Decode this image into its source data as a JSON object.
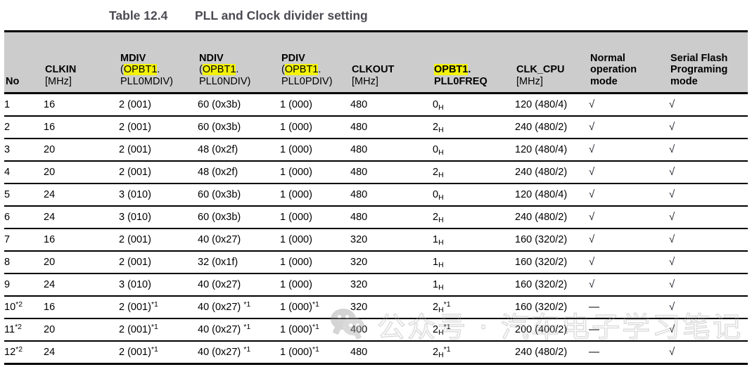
{
  "caption": {
    "label": "Table 12.4",
    "title": "PLL and Clock divider setting"
  },
  "colors": {
    "header_bg": "#cccccc",
    "highlight": "#f2f20a",
    "caption_text": "#4a4a52",
    "rule": "#000000"
  },
  "table": {
    "headers": [
      {
        "main": "",
        "line2": "",
        "line3": "No",
        "bold_lines": [
          3
        ]
      },
      {
        "main": "CLKIN",
        "line3": "[MHz]"
      },
      {
        "main": "MDIV",
        "line2_prefix": "(",
        "line2_hl": "OPBT1",
        "line2_suffix": ".",
        "line3": "PLL0MDIV)"
      },
      {
        "main": "NDIV",
        "line2_prefix": "(",
        "line2_hl": "OPBT1",
        "line2_suffix": ".",
        "line3": "PLL0NDIV)"
      },
      {
        "main": "PDIV",
        "line2_prefix": "(",
        "line2_hl": "OPBT1",
        "line2_suffix": ".",
        "line3": "PLL0PDIV)"
      },
      {
        "main": "CLKOUT",
        "line3": "[MHz]"
      },
      {
        "main": "",
        "line2_hl": "OPBT1",
        "line2_suffix": ".",
        "line3": "PLL0FREQ"
      },
      {
        "main": "CLK_CPU",
        "line3": "[MHz]"
      },
      {
        "main": "Normal",
        "line2": "operation",
        "line3": "mode"
      },
      {
        "main": "Serial Flash",
        "line2": "Programing",
        "line3": "mode"
      }
    ],
    "header_labels": {
      "no": "No",
      "clkin": "CLKIN",
      "clkin_unit": "[MHz]",
      "mdiv": "MDIV",
      "mdiv_reg_open": "(",
      "mdiv_reg_hl": "OPBT1",
      "mdiv_reg_dot": ".",
      "mdiv_reg_rest": "PLL0MDIV)",
      "ndiv": "NDIV",
      "ndiv_reg_open": "(",
      "ndiv_reg_hl": "OPBT1",
      "ndiv_reg_dot": ".",
      "ndiv_reg_rest": "PLL0NDIV)",
      "pdiv": "PDIV",
      "pdiv_reg_open": "(",
      "pdiv_reg_hl": "OPBT1",
      "pdiv_reg_dot": ".",
      "pdiv_reg_rest": "PLL0PDIV)",
      "clkout": "CLKOUT",
      "clkout_unit": "[MHz]",
      "freq_hl": "OPBT1",
      "freq_dot": ".",
      "freq_rest": "PLL0FREQ",
      "clk_cpu": "CLK_CPU",
      "clk_cpu_unit": "[MHz]",
      "normal_l1": "Normal",
      "normal_l2": "operation",
      "normal_l3": "mode",
      "serial_l1": "Serial Flash",
      "serial_l2": "Programing",
      "serial_l3": "mode"
    },
    "rows": [
      {
        "no": "1",
        "no_sup": "",
        "clkin": "16",
        "mdiv": "2 (001)",
        "mdiv_sup": "",
        "ndiv": "60 (0x3b)",
        "ndiv_sup": "",
        "pdiv": "1 (000)",
        "pdiv_sup": "",
        "clkout": "480",
        "freq": "0",
        "freq_sub": "H",
        "freq_sup": "",
        "clk_cpu": "120 (480/4)",
        "normal": "√",
        "serial": "√"
      },
      {
        "no": "2",
        "no_sup": "",
        "clkin": "16",
        "mdiv": "2 (001)",
        "mdiv_sup": "",
        "ndiv": "60 (0x3b)",
        "ndiv_sup": "",
        "pdiv": "1 (000)",
        "pdiv_sup": "",
        "clkout": "480",
        "freq": "2",
        "freq_sub": "H",
        "freq_sup": "",
        "clk_cpu": "240 (480/2)",
        "normal": "√",
        "serial": "√"
      },
      {
        "no": "3",
        "no_sup": "",
        "clkin": "20",
        "mdiv": "2 (001)",
        "mdiv_sup": "",
        "ndiv": "48 (0x2f)",
        "ndiv_sup": "",
        "pdiv": "1 (000)",
        "pdiv_sup": "",
        "clkout": "480",
        "freq": "0",
        "freq_sub": "H",
        "freq_sup": "",
        "clk_cpu": "120 (480/4)",
        "normal": "√",
        "serial": "√"
      },
      {
        "no": "4",
        "no_sup": "",
        "clkin": "20",
        "mdiv": "2 (001)",
        "mdiv_sup": "",
        "ndiv": "48 (0x2f)",
        "ndiv_sup": "",
        "pdiv": "1 (000)",
        "pdiv_sup": "",
        "clkout": "480",
        "freq": "2",
        "freq_sub": "H",
        "freq_sup": "",
        "clk_cpu": "240 (480/2)",
        "normal": "√",
        "serial": "√"
      },
      {
        "no": "5",
        "no_sup": "",
        "clkin": "24",
        "mdiv": "3 (010)",
        "mdiv_sup": "",
        "ndiv": "60 (0x3b)",
        "ndiv_sup": "",
        "pdiv": "1 (000)",
        "pdiv_sup": "",
        "clkout": "480",
        "freq": "0",
        "freq_sub": "H",
        "freq_sup": "",
        "clk_cpu": "120 (480/4)",
        "normal": "√",
        "serial": "√"
      },
      {
        "no": "6",
        "no_sup": "",
        "clkin": "24",
        "mdiv": "3 (010)",
        "mdiv_sup": "",
        "ndiv": "60 (0x3b)",
        "ndiv_sup": "",
        "pdiv": "1 (000)",
        "pdiv_sup": "",
        "clkout": "480",
        "freq": "2",
        "freq_sub": "H",
        "freq_sup": "",
        "clk_cpu": "240 (480/2)",
        "normal": "√",
        "serial": "√"
      },
      {
        "no": "7",
        "no_sup": "",
        "clkin": "16",
        "mdiv": "2 (001)",
        "mdiv_sup": "",
        "ndiv": "40 (0x27)",
        "ndiv_sup": "",
        "pdiv": "1 (000)",
        "pdiv_sup": "",
        "clkout": "320",
        "freq": "1",
        "freq_sub": "H",
        "freq_sup": "",
        "clk_cpu": "160 (320/2)",
        "normal": "√",
        "serial": "√"
      },
      {
        "no": "8",
        "no_sup": "",
        "clkin": "20",
        "mdiv": "2 (001)",
        "mdiv_sup": "",
        "ndiv": "32 (0x1f)",
        "ndiv_sup": "",
        "pdiv": "1 (000)",
        "pdiv_sup": "",
        "clkout": "320",
        "freq": "1",
        "freq_sub": "H",
        "freq_sup": "",
        "clk_cpu": "160 (320/2)",
        "normal": "√",
        "serial": "√"
      },
      {
        "no": "9",
        "no_sup": "",
        "clkin": "24",
        "mdiv": "3 (010)",
        "mdiv_sup": "",
        "ndiv": "40 (0x27)",
        "ndiv_sup": "",
        "pdiv": "1 (000)",
        "pdiv_sup": "",
        "clkout": "320",
        "freq": "1",
        "freq_sub": "H",
        "freq_sup": "",
        "clk_cpu": "160 (320/2)",
        "normal": "√",
        "serial": "√"
      },
      {
        "no": "10",
        "no_sup": "*2",
        "clkin": "16",
        "mdiv": "2 (001)",
        "mdiv_sup": "*1",
        "ndiv": "40 (0x27) ",
        "ndiv_sup": "*1",
        "pdiv": "1 (000)",
        "pdiv_sup": "*1",
        "clkout": "320",
        "freq": "2",
        "freq_sub": "H",
        "freq_sup": "*1",
        "clk_cpu": "160 (320/2)",
        "normal": "—",
        "serial": "√"
      },
      {
        "no": "11",
        "no_sup": "*2",
        "clkin": "20",
        "mdiv": "2 (001)",
        "mdiv_sup": "*1",
        "ndiv": "40 (0x27) ",
        "ndiv_sup": "*1",
        "pdiv": "1 (000)",
        "pdiv_sup": "*1",
        "clkout": "400",
        "freq": "2",
        "freq_sub": "H",
        "freq_sup": "*1",
        "clk_cpu": "200 (400/2)",
        "normal": "—",
        "serial": "√"
      },
      {
        "no": "12",
        "no_sup": "*2",
        "clkin": "24",
        "mdiv": "2 (001)",
        "mdiv_sup": "*1",
        "ndiv": "40 (0x27) ",
        "ndiv_sup": "*1",
        "pdiv": "1 (000)",
        "pdiv_sup": "*1",
        "clkout": "480",
        "freq": "2",
        "freq_sub": "H",
        "freq_sup": "*1",
        "clk_cpu": "240 (480/2)",
        "normal": "—",
        "serial": "√"
      }
    ]
  },
  "watermark": {
    "text": "公众号 · 汽车电子学习笔记",
    "logo": "wechat-logo"
  }
}
